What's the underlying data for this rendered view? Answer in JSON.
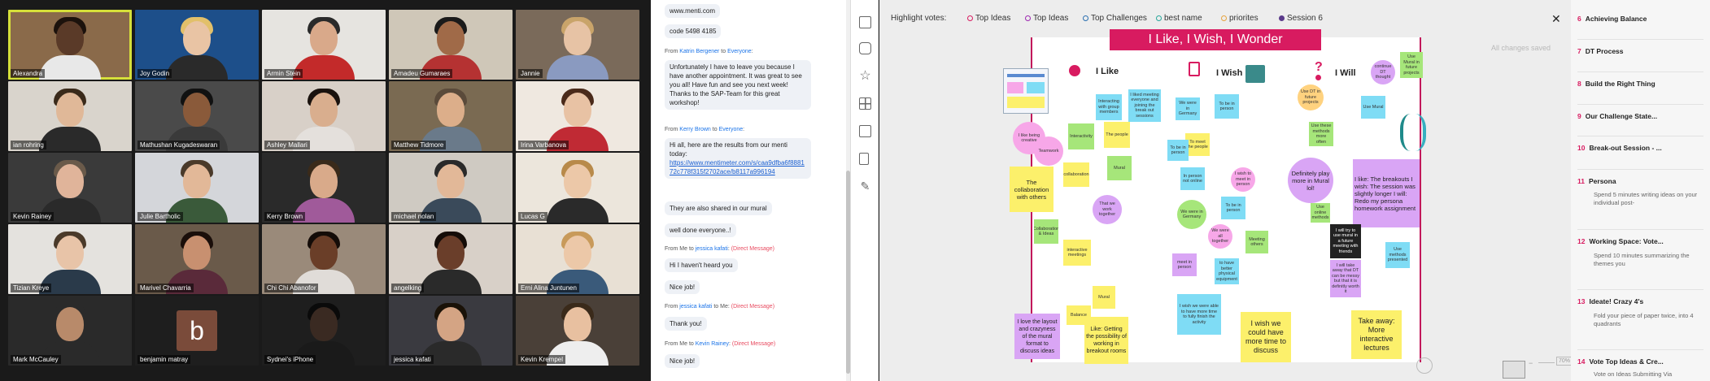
{
  "gallery": {
    "participants": [
      {
        "name": "Alexandra",
        "bg": "#8a6a4a",
        "skin": "#5a3a28",
        "shirt": "#e8e8e8",
        "hair": "#1c120c"
      },
      {
        "name": "Joy Godin",
        "bg": "#1d4f8a",
        "skin": "#e9c4a4",
        "shirt": "#2a2a2a",
        "hair": "#e2c06a"
      },
      {
        "name": "Armin Stein",
        "bg": "#e6e4e0",
        "skin": "#d9a98a",
        "shirt": "#c32a2a",
        "hair": "#2a2a2a"
      },
      {
        "name": "Amadeu Gumaraes",
        "bg": "#cfc7b8",
        "skin": "#a06a48",
        "shirt": "#b53232",
        "hair": "#1a1a1a"
      },
      {
        "name": "Jannie",
        "bg": "#7a6a5a",
        "skin": "#e7c3a5",
        "shirt": "#8a9ac0",
        "hair": "#c9a46a"
      },
      {
        "name": "ian rohring",
        "bg": "#d9d4cc",
        "skin": "#e0b898",
        "shirt": "#2a2a2a",
        "hair": "#3a2a1a"
      },
      {
        "name": "Mathushan Kugadeswaran",
        "bg": "#4a4a4a",
        "skin": "#8a5a3a",
        "shirt": "#3a3a3a",
        "hair": "#111111"
      },
      {
        "name": "Ashley Mallari",
        "bg": "#d8d0c8",
        "skin": "#d9ae8e",
        "shirt": "#e4e0dc",
        "hair": "#1a120e"
      },
      {
        "name": "Matthew Tidmore",
        "bg": "#7a6a52",
        "skin": "#dcae8a",
        "shirt": "#6a7a8a",
        "hair": "#5a4a3a"
      },
      {
        "name": "Irina Varbanova",
        "bg": "#efe8e0",
        "skin": "#e8c2a4",
        "shirt": "#c02a34",
        "hair": "#4a2a1a"
      },
      {
        "name": "Kevin Rainey",
        "bg": "#3a3a3a",
        "skin": "#e0b49a",
        "shirt": "#2a2a2a",
        "hair": "#6a5a4a"
      },
      {
        "name": "Julie Bartholic",
        "bg": "#d4d6da",
        "skin": "#e2b898",
        "shirt": "#3a5a3a",
        "hair": "#4a3a2a"
      },
      {
        "name": "Kerry Brown",
        "bg": "#2a2a2a",
        "skin": "#d9aa8a",
        "shirt": "#a05a9a",
        "hair": "#3a2a1a"
      },
      {
        "name": "michael nolan",
        "bg": "#cfcac2",
        "skin": "#e2b898",
        "shirt": "#3a4a5a",
        "hair": "#2a2a2a"
      },
      {
        "name": "Lucas G",
        "bg": "#ece6dc",
        "skin": "#ecc8a8",
        "shirt": "#2a2a2a",
        "hair": "#b88a4a"
      },
      {
        "name": "Tizian Kreye",
        "bg": "#e4e2de",
        "skin": "#e8c4a8",
        "shirt": "#2a3a4a",
        "hair": "#4a3a2a"
      },
      {
        "name": "Marivel Chavarria",
        "bg": "#6a5a4a",
        "skin": "#c89070",
        "shirt": "#5a2a3a",
        "hair": "#1a0e0a"
      },
      {
        "name": "Chi Chi Abanofor",
        "bg": "#9a8a7a",
        "skin": "#6a3e28",
        "shirt": "#e0dcd8",
        "hair": "#140c08"
      },
      {
        "name": "angelking",
        "bg": "#d8d0c8",
        "skin": "#6a3e2a",
        "shirt": "#2a2a2a",
        "hair": "#140c08"
      },
      {
        "name": "Erni Alina Juntunen",
        "bg": "#e8e0d4",
        "skin": "#ecc8a8",
        "shirt": "#3a5a7a",
        "hair": "#c89a5a"
      },
      {
        "name": "Mark McCauley",
        "bg": "#2a2a2a",
        "skin": "#b88a6a",
        "shirt": "#2a2a2a",
        "hair": "#2a2a2a"
      },
      {
        "name": "benjamin matray",
        "bg": "#1e1e1e",
        "letter": "b"
      },
      {
        "name": "Sydnei's iPhone",
        "bg": "#1e1e1e",
        "skin": "#3a2a22",
        "shirt": "#1a1a1a",
        "hair": "#0a0a0a"
      },
      {
        "name": "jessica kafati",
        "bg": "#3a3a40",
        "skin": "#d4a484",
        "shirt": "#2a2a2a",
        "hair": "#1a1208"
      },
      {
        "name": "Kevin Krempel",
        "bg": "#4a4038",
        "skin": "#e8c0a0",
        "shirt": "#eeeeee",
        "hair": "#3a2a1a"
      }
    ]
  },
  "chat": {
    "msg_menti": "www.menti.com",
    "msg_code": "code 5498 4185",
    "meta1": {
      "from": "From",
      "sender": "Katrin Bergener",
      "to": "to",
      "recipient": "Everyone",
      "suffix": ":"
    },
    "msg_katrin": "Unfortunately I have to leave you because I have another appointment. It was great to see you all! Have fun and see you next week! Thanks to the SAP-Team for this great workshop!",
    "meta2": {
      "from": "From",
      "sender": "Kerry Brown",
      "to": "to",
      "recipient": "Everyone",
      "suffix": ":"
    },
    "msg_kerry": "Hi all, here are the results from our menti today:",
    "msg_kerry_link": "https://www.mentimeter.com/s/caa9dfba6f888172c778f315f2702ace/b8117a996194",
    "msg_shared": "They are also shared in our mural",
    "msg_welldone": "well done everyone..!",
    "meta3": {
      "from": "From Me to",
      "recipient": "jessica kafati",
      "dm": "(Direct Message)"
    },
    "msg_heard": "Hi I haven't heard you",
    "msg_nice1": "Nice job!",
    "meta4": {
      "from": "From",
      "sender": "jessica kafati",
      "to": "to Me:",
      "dm": "(Direct Message)"
    },
    "msg_thank": "Thank you!",
    "meta5": {
      "from": "From Me to",
      "recipient": "Kevin Rainey",
      "dm": "(Direct Message)"
    },
    "msg_nice2": "Nice job!"
  },
  "canvas": {
    "vote_label": "Highlight votes:",
    "chips": [
      {
        "label": "Top Ideas",
        "color": "#d81b60",
        "style": "ring"
      },
      {
        "label": "Top Ideas",
        "color": "#9c27b0",
        "style": "ring"
      },
      {
        "label": "Top Challenges",
        "color": "#2a6fb0",
        "style": "ring"
      },
      {
        "label": "best name",
        "color": "#26a69a",
        "style": "ring"
      },
      {
        "label": "priorites",
        "color": "#e6a23c",
        "style": "ring"
      },
      {
        "label": "Session 6",
        "color": "#5a3a8a",
        "style": "dot"
      }
    ],
    "close": "✕",
    "saved": "All changes saved",
    "board_title": "I Like, I Wish, I Wonder",
    "col_like": "I Like",
    "col_wish": "I Wish",
    "col_will": "I Will",
    "notes": {
      "n1": "I like being creative",
      "n2": "Teamwork",
      "n3": "Interactivity",
      "n4": "The people",
      "n5": "The collaboration with others",
      "n6": "collaboration",
      "n7": "Mural",
      "n8": "That we work together",
      "n9": "I liked meeting everyone and joining the break out sessions",
      "n10": "Interacting with group members",
      "n11": "Collaboration & Ideas",
      "n12": "interactive meetings",
      "n13": "Balance",
      "n14": "Mural",
      "n15": "I love the layout and crazyness of the mural format to discuss ideas",
      "n16": "Like: Getting the possibility of working in breakout rooms",
      "n17": "We were in Germany",
      "n18": "To be in person",
      "n19": "To meet the people",
      "n20": "To be in person",
      "n21": "In person not online",
      "n22": "I wish to meet in person",
      "n23": "We were in Germany",
      "n24": "To be in person",
      "n25": "We were all together",
      "n26": "Meeting others",
      "n27": "meet in person",
      "n28": "to have better physical equipment",
      "n29": "I wish we were able to have more time to fully finish the activity",
      "n30": "I wish we could have more time to discuss",
      "n31": "continue DT thought",
      "n32": "Use Mural in future projects",
      "n33": "Use DT in future projects",
      "n34": "Use Mural",
      "n35": "Use these methods more often",
      "n36": "Definitely play more in Mural lol!",
      "n37": "I like: The breakouts I wish: The session was slightly longer I will: Redo my persona homework assignment",
      "n38": "I will try to use mural in a future meeting with friends",
      "n39": "Use online methods",
      "n40": "I will take away that DT can be messy but that it is definitly worth it",
      "n41": "Use methods presented",
      "n42": "Take away: More interactive lectures"
    },
    "zoom": "70%"
  },
  "outline": {
    "items": [
      {
        "n": "6",
        "label": "Achieving Balance"
      },
      {
        "n": "7",
        "label": "DT Process"
      },
      {
        "n": "8",
        "label": "Build the Right Thing"
      },
      {
        "n": "9",
        "label": "Our Challenge State..."
      },
      {
        "n": "10",
        "label": "Break-out Session - ..."
      },
      {
        "n": "11",
        "label": "Persona"
      },
      {
        "n": "12",
        "label": "Working Space: Vote..."
      },
      {
        "n": "13",
        "label": "Ideate! Crazy 4's"
      },
      {
        "n": "14",
        "label": "Vote Top Ideas & Cre..."
      }
    ],
    "sub11": "Spend 5 minutes writing ideas on your individual post-",
    "sub12": "Spend 10 minutes summarizing the themes you",
    "sub13": "Fold your piece of paper twice, into 4 quadrants",
    "sub14": "Vote on Ideas Submitting Via"
  }
}
